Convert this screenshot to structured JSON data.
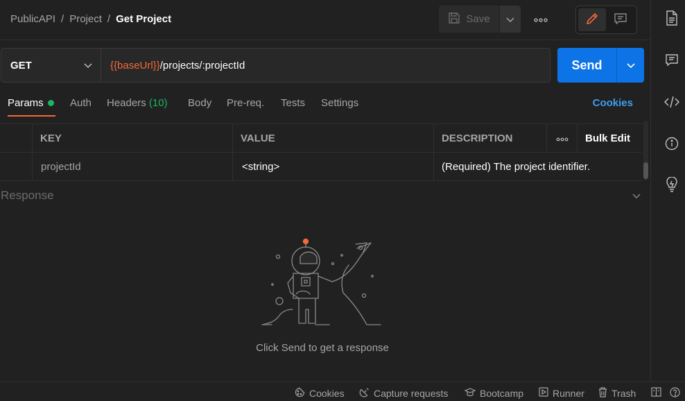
{
  "breadcrumb": {
    "items": [
      "PublicAPI",
      "Project"
    ],
    "current": "Get Project",
    "separator": "/"
  },
  "toolbar": {
    "save_label": "Save"
  },
  "request": {
    "method": "GET",
    "url_variable": "{{baseUrl}}",
    "url_path": "/projects/:projectId",
    "send_label": "Send"
  },
  "tabs": {
    "params": "Params",
    "auth": "Auth",
    "headers": "Headers",
    "headers_count": "(10)",
    "body": "Body",
    "prereq": "Pre-req.",
    "tests": "Tests",
    "settings": "Settings",
    "cookies_link": "Cookies"
  },
  "params_table": {
    "columns": [
      "KEY",
      "VALUE",
      "DESCRIPTION"
    ],
    "bulk_edit": "Bulk Edit",
    "rows": [
      {
        "key": "projectId",
        "value": "<string>",
        "description": "(Required) The project identifier."
      }
    ]
  },
  "response": {
    "title": "Response",
    "empty_message": "Click Send to get a response"
  },
  "footer": {
    "cookies": "Cookies",
    "capture": "Capture requests",
    "bootcamp": "Bootcamp",
    "runner": "Runner",
    "trash": "Trash"
  },
  "colors": {
    "accent_orange": "#f26b3a",
    "send_blue": "#0d74e7",
    "link_blue": "#3d9df3",
    "status_green": "#1bb661"
  }
}
